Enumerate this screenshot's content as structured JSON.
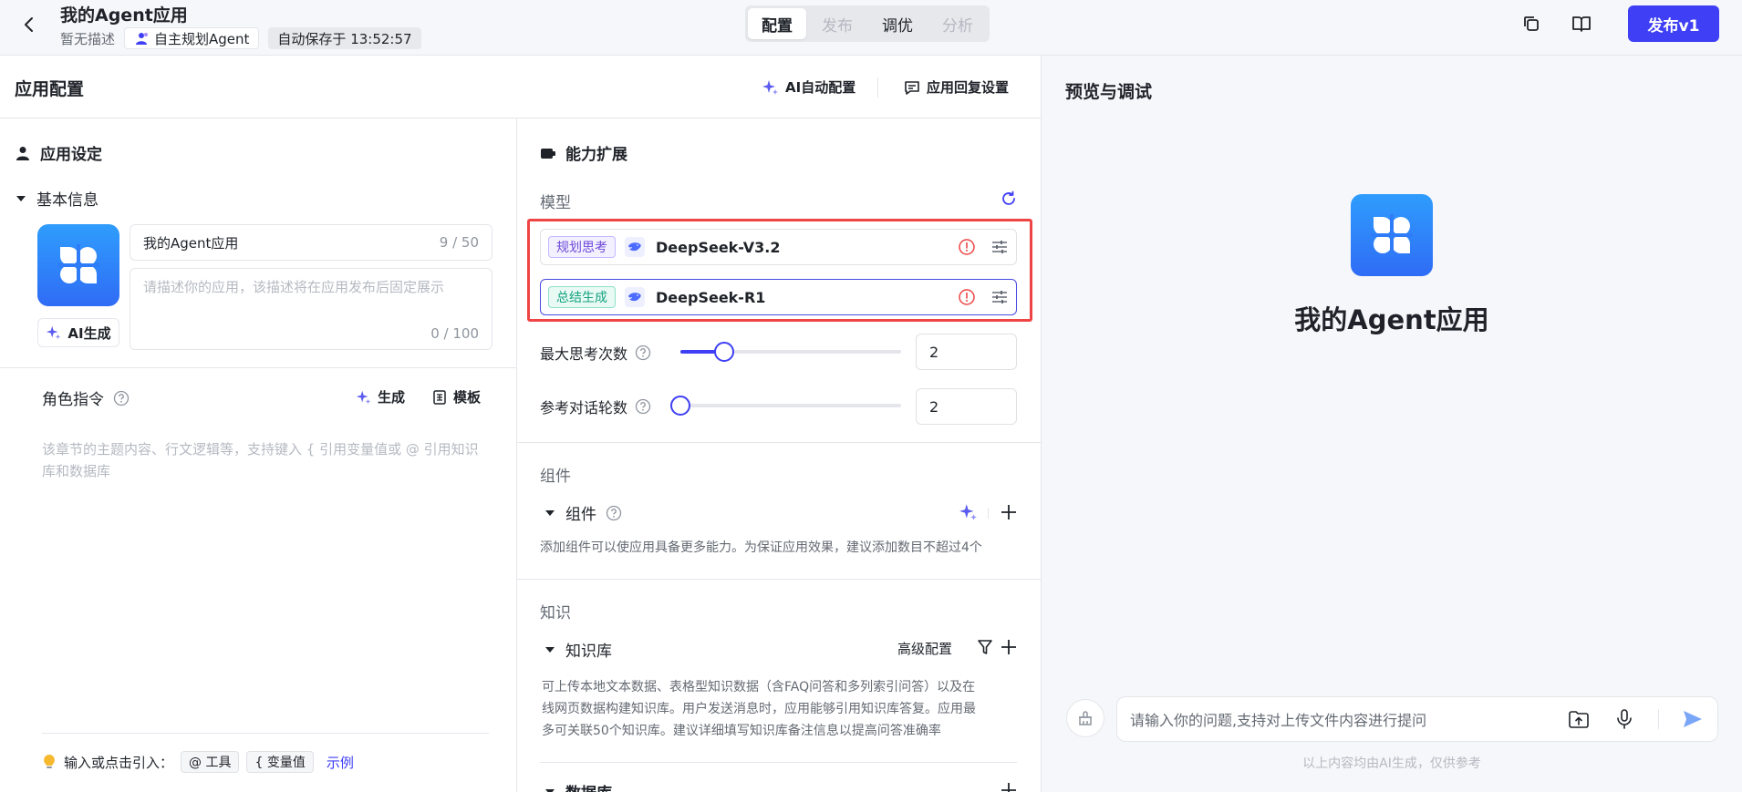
{
  "topbar": {
    "title": "我的Agent应用",
    "description": "暂无描述",
    "agent_tag": "自主规划Agent",
    "autosave": "自动保存于 13:52:57",
    "tabs": [
      {
        "label": "配置",
        "state": "active"
      },
      {
        "label": "发布",
        "state": "disabled"
      },
      {
        "label": "调优",
        "state": "normal"
      },
      {
        "label": "分析",
        "state": "disabled"
      }
    ],
    "publish_label": "发布v1"
  },
  "config": {
    "title": "应用配置",
    "ai_auto_config": "AI自动配置",
    "reply_settings": "应用回复设置"
  },
  "app_settings": {
    "title": "应用设定",
    "basic_info": "基本信息",
    "name_value": "我的Agent应用",
    "name_counter": "9 / 50",
    "desc_placeholder": "请描述你的应用，该描述将在应用发布后固定展示",
    "desc_counter": "0 / 100",
    "ai_generate": "AI生成",
    "role_title": "角色指令",
    "generate": "生成",
    "template": "模板",
    "role_placeholder": "该章节的主题内容、行文逻辑等，支持键入 { 引用变量值或 @ 引用知识库和数据库",
    "hint_label": "输入或点击引入：",
    "chip_tool": "@ 工具",
    "chip_var": "{ 变量值",
    "example_link": "示例"
  },
  "capabilities": {
    "title": "能力扩展",
    "model_label": "模型",
    "models": [
      {
        "tag": "规划思考",
        "name": "DeepSeek-V3.2"
      },
      {
        "tag": "总结生成",
        "name": "DeepSeek-R1"
      }
    ],
    "max_think_label": "最大思考次数",
    "max_think_value": "2",
    "max_think_fraction": 0.2,
    "ref_rounds_label": "参考对话轮数",
    "ref_rounds_value": "2",
    "ref_rounds_fraction": 0.0,
    "components_heading": "组件",
    "components_title": "组件",
    "components_desc": "添加组件可以使应用具备更多能力。为保证应用效果，建议添加数目不超过4个",
    "knowledge_heading": "知识",
    "kb_title": "知识库",
    "kb_advanced": "高级配置",
    "kb_desc_lines": [
      "可上传本地文本数据、表格型知识数据（含FAQ问答和多列索引问答）以及在",
      "线网页数据构建知识库。用户发送消息时，应用能够引用知识库答复。应用最",
      "多可关联50个知识库。建议详细填写知识库备注信息以提高问答准确率"
    ],
    "database_title": "数据库"
  },
  "preview": {
    "title": "预览与调试",
    "app_name": "我的Agent应用",
    "input_placeholder": "请输入你的问题,支持对上传文件内容进行提问",
    "disclaimer": "以上内容均由AI生成，仅供参考"
  },
  "colors": {
    "accent": "#3f3ff5",
    "highlight_box": "#ef4444",
    "warning": "#ef4444"
  }
}
